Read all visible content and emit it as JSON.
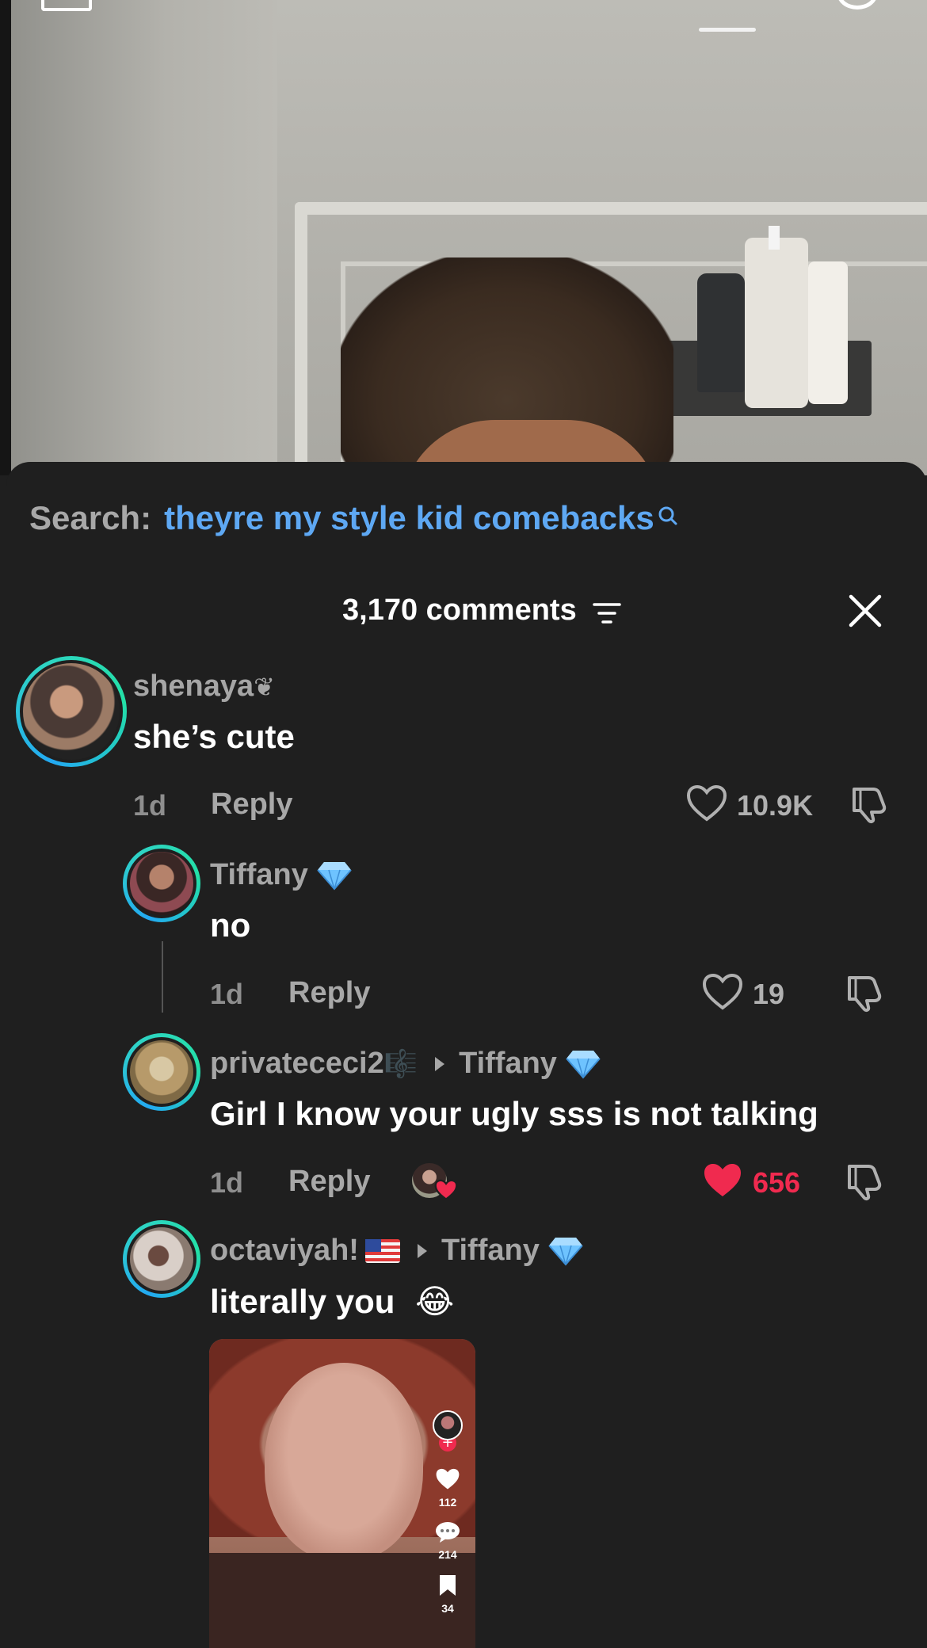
{
  "search": {
    "label": "Search:",
    "term": "theyre my style kid comebacks"
  },
  "header": {
    "comments_count": "3,170 comments"
  },
  "comments": [
    {
      "username": "shenaya",
      "username_suffix": "❦",
      "text": "she’s cute",
      "time": "1d",
      "reply_label": "Reply",
      "likes": "10.9K",
      "liked": false
    },
    {
      "username": "Tiffany",
      "text": "no",
      "time": "1d",
      "reply_label": "Reply",
      "likes": "19",
      "liked": false
    },
    {
      "username": "privatececi2",
      "username_suffix": "🎼",
      "reply_to": "Tiffany",
      "text": "Girl I know your ugly sss is not talking",
      "time": "1d",
      "reply_label": "Reply",
      "likes": "656",
      "liked": true
    },
    {
      "username": "octaviyah!",
      "reply_to": "Tiffany",
      "text": "literally you",
      "emoji": "😂",
      "attachment": {
        "likes": "112",
        "comments": "214",
        "saves": "34"
      }
    }
  ],
  "colors": {
    "sheet_bg": "#1f1f1f",
    "search_term": "#5ea8f3",
    "liked": "#f02a4f",
    "avatar_ring_start": "#23a9f2",
    "avatar_ring_end": "#23e0a6",
    "verified_diamond": "#6ec3ff"
  },
  "icons": [
    "search-icon",
    "filter-icon",
    "close-icon",
    "heart-icon",
    "dislike-icon",
    "diamond-badge-icon",
    "flag-us-icon",
    "comment-bubble-icon",
    "bookmark-icon"
  ]
}
